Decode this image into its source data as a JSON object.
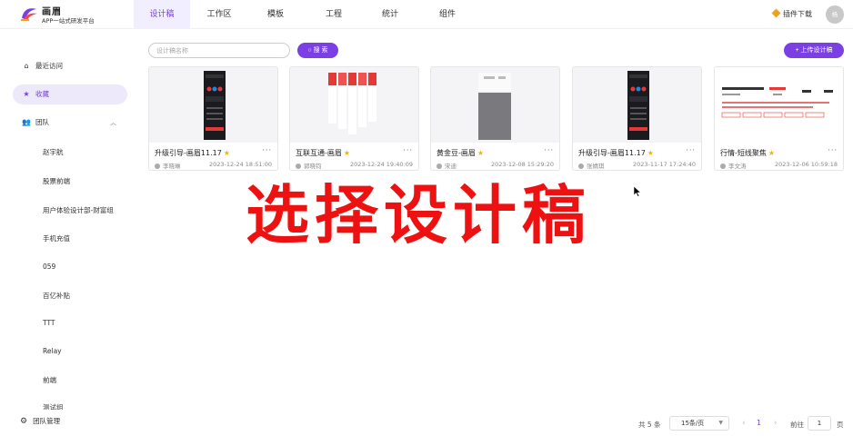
{
  "header": {
    "logo_name": "画眉",
    "logo_sub": "APP一站式研发平台",
    "tabs": [
      {
        "label": "设计稿",
        "active": true
      },
      {
        "label": "工作区"
      },
      {
        "label": "模板"
      },
      {
        "label": "工程"
      },
      {
        "label": "统计"
      },
      {
        "label": "组件"
      }
    ],
    "plugin_download": "插件下载",
    "avatar_text": "杨"
  },
  "sidebar": {
    "recent": "最近访问",
    "favorites": "收藏",
    "team": "团队",
    "teams": [
      "赵宇航",
      "股票前端",
      "用户体验设计部-财富组",
      "手机充值",
      "059",
      "百亿补贴",
      "TTT",
      "Relay",
      "前端",
      "测试组"
    ],
    "team_management": "团队管理"
  },
  "toolbar": {
    "search_placeholder": "设计稿名称",
    "search_button": "搜 索",
    "upload_button": "+ 上传设计稿"
  },
  "cards": [
    {
      "name": "升级引导-画眉11.17",
      "user": "李晓琳",
      "time": "2023-12-24 18:51:00"
    },
    {
      "name": "互联互通-画眉",
      "user": "郭晓钧",
      "time": "2023-12-24 19:40:09"
    },
    {
      "name": "黄金豆-画眉",
      "user": "宋迪",
      "time": "2023-12-08 15:29:20"
    },
    {
      "name": "升级引导-画眉11.17",
      "user": "张婧琪",
      "time": "2023-11-17 17:24:40"
    },
    {
      "name": "行情-短线聚焦",
      "user": "李文涛",
      "time": "2023-12-06 10:59:18"
    }
  ],
  "overlay_text": "选择设计稿",
  "pagination": {
    "total": "共 5 条",
    "page_size": "15条/页",
    "current_page": "1",
    "goto_label": "前往",
    "goto_value": "1",
    "page_suffix": "页"
  },
  "colors": {
    "accent": "#7b3fe4",
    "overlay": "#ee1111",
    "star": "#f0b400"
  }
}
